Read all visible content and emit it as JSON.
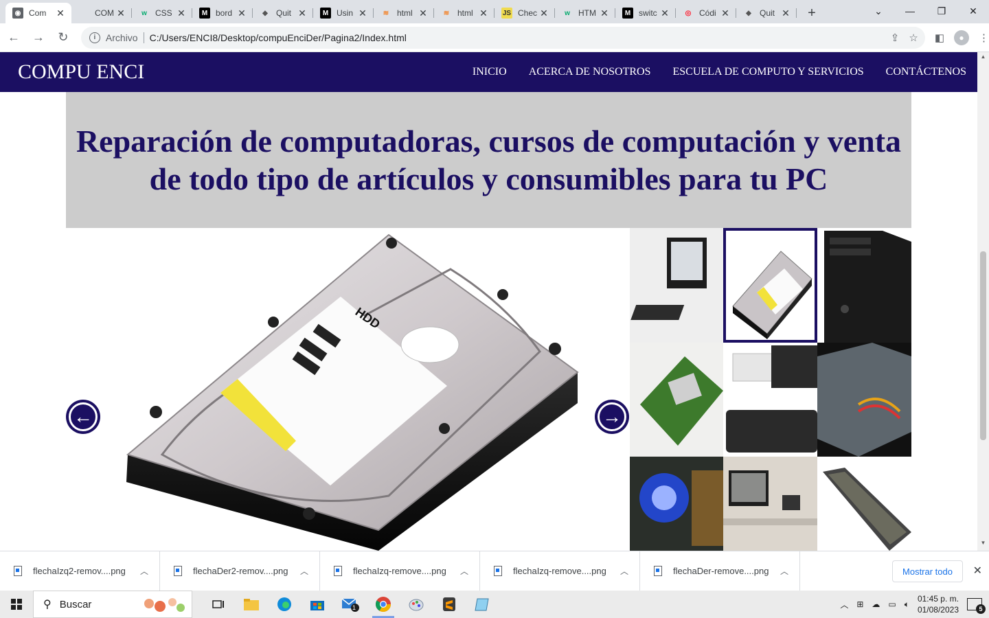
{
  "browser": {
    "tabs": [
      {
        "title": "Com",
        "icon": "globe",
        "active": true
      },
      {
        "title": "COM",
        "icon": "none"
      },
      {
        "title": "CSS",
        "icon": "w3schools"
      },
      {
        "title": "bord",
        "icon": "medium"
      },
      {
        "title": "Quit",
        "icon": "stack"
      },
      {
        "title": "Usin",
        "icon": "medium"
      },
      {
        "title": "html",
        "icon": "stackoverflow"
      },
      {
        "title": "html",
        "icon": "stackoverflow"
      },
      {
        "title": "Chec",
        "icon": "js"
      },
      {
        "title": "HTM",
        "icon": "w3schools"
      },
      {
        "title": "switc",
        "icon": "medium"
      },
      {
        "title": "Códi",
        "icon": "opera"
      },
      {
        "title": "Quit",
        "icon": "stack"
      }
    ],
    "new_tab": "+",
    "address": {
      "protocol_label": "Archivo",
      "url": "C:/Users/ENCI8/Desktop/compuEnciDer/Pagina2/Index.html"
    }
  },
  "site": {
    "brand": "COMPU ENCI",
    "nav": [
      "INICIO",
      "ACERCA DE NOSOTROS",
      "ESCUELA DE COMPUTO Y SERVICIOS",
      "CONTÁCTENOS"
    ],
    "hero_title": "Reparación de computadoras, cursos de computación y venta de todo tipo de artículos y consumibles para tu PC",
    "gallery": {
      "main_image": "hard-drive",
      "thumbnails": [
        "desktop-computer",
        "hard-drive",
        "pc-tower",
        "network-card",
        "usb-drive",
        "power-supply",
        "graphics-card",
        "computer-lab",
        "laptop-screen"
      ],
      "selected_index": 1
    }
  },
  "downloads": {
    "items": [
      "flechaIzq2-remov....png",
      "flechaDer2-remov....png",
      "flechaIzq-remove....png",
      "flechaIzq-remove....png",
      "flechaDer-remove....png"
    ],
    "show_all": "Mostrar todo"
  },
  "taskbar": {
    "search_placeholder": "Buscar",
    "time": "01:45 p. m.",
    "date": "01/08/2023",
    "mail_badge": "1",
    "notifications": "5"
  },
  "colors": {
    "brand": "#1b0f62",
    "hero_bg": "#cccccc"
  }
}
